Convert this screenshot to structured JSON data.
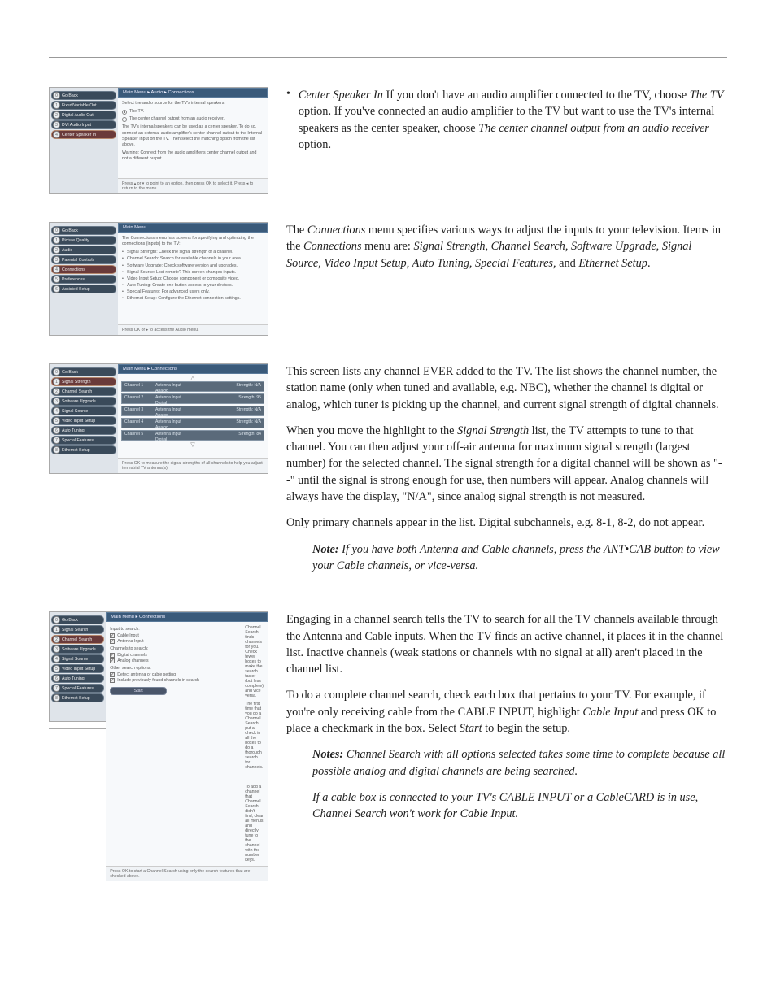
{
  "shot1": {
    "crumb": "Main Menu ▸ Audio ▸ Connections",
    "menu": [
      {
        "n": "0",
        "l": "Go Back",
        "sel": false
      },
      {
        "n": "1",
        "l": "Fixed/Variable Out",
        "sel": false
      },
      {
        "n": "2",
        "l": "Digital Audio Out",
        "sel": false
      },
      {
        "n": "3",
        "l": "DVI Audio Input",
        "sel": false
      },
      {
        "n": "4",
        "l": "Center Speaker In",
        "sel": true
      }
    ],
    "intro": "Select the audio source for the TV's internal speakers:",
    "opt1": "The TV.",
    "opt2": "The center channel output from an audio receiver.",
    "para1": "The TV's internal speakers can be used as a center speaker. To do so, connect an external audio amplifier's center channel output to the Internal Speaker Input on the TV. Then select the matching option from the list above.",
    "para2": "Warning: Connect from the audio amplifier's center channel output and not a different output.",
    "hint": "Press ▴ or ▾ to point to an option, then press OK to select it. Press ◂ to return to the menu."
  },
  "shot2": {
    "crumb": "Main Menu",
    "menu": [
      {
        "n": "0",
        "l": "Go Back",
        "sel": false
      },
      {
        "n": "1",
        "l": "Picture Quality",
        "sel": false
      },
      {
        "n": "2",
        "l": "Audio",
        "sel": false
      },
      {
        "n": "3",
        "l": "Parental Controls",
        "sel": false
      },
      {
        "n": "4",
        "l": "Connections",
        "sel": true
      },
      {
        "n": "5",
        "l": "Preferences",
        "sel": false
      },
      {
        "n": "6",
        "l": "Assisted Setup",
        "sel": false
      }
    ],
    "intro": "The Connections menu has screens for specifying and optimizing the connections (inputs) to the TV:",
    "items": [
      "Signal Strength: Check the signal strength of a channel.",
      "Channel Search: Search for available channels in your area.",
      "Software Upgrade: Check software version and upgrades.",
      "Signal Source: Lost remote? This screen changes inputs.",
      "Video Input Setup: Choose component or composite video.",
      "Auto Tuning: Create one button access to your devices.",
      "Special Features: For advanced users only.",
      "Ethernet Setup: Configure the Ethernet connection settings."
    ],
    "hint": "Press OK or ▸ to access the Audio menu."
  },
  "shot3": {
    "crumb": "Main Menu ▸ Connections",
    "menu": [
      {
        "n": "0",
        "l": "Go Back",
        "sel": false
      },
      {
        "n": "1",
        "l": "Signal Strength",
        "sel": true
      },
      {
        "n": "2",
        "l": "Channel Search",
        "sel": false
      },
      {
        "n": "3",
        "l": "Software Upgrade",
        "sel": false
      },
      {
        "n": "4",
        "l": "Signal Source",
        "sel": false
      },
      {
        "n": "5",
        "l": "Video Input Setup",
        "sel": false
      },
      {
        "n": "6",
        "l": "Auto Tuning",
        "sel": false
      },
      {
        "n": "7",
        "l": "Special Features",
        "sel": false
      },
      {
        "n": "8",
        "l": "Ethernet Setup",
        "sel": false
      }
    ],
    "rows": [
      {
        "ch": "Channel 1",
        "inp": "Antenna Input",
        "typ": "Analog",
        "str": "Strength: N/A"
      },
      {
        "ch": "Channel 2",
        "inp": "Antenna Input",
        "typ": "Digital",
        "str": "Strength: 95"
      },
      {
        "ch": "Channel 3",
        "inp": "Antenna Input",
        "typ": "Analog",
        "str": "Strength: N/A"
      },
      {
        "ch": "Channel 4",
        "inp": "Antenna Input",
        "typ": "Analog",
        "str": "Strength: N/A"
      },
      {
        "ch": "Channel 5",
        "inp": "Antenna Input",
        "typ": "Digital",
        "str": "Strength: 84"
      }
    ],
    "hint": "Press OK to measure the signal strengths of all channels to help you adjust terrestrial TV antenna(s)."
  },
  "shot4": {
    "crumb": "Main Menu ▸ Connections",
    "menu": [
      {
        "n": "0",
        "l": "Go Back",
        "sel": false
      },
      {
        "n": "1",
        "l": "Signal Search",
        "sel": false
      },
      {
        "n": "2",
        "l": "Channel Search",
        "sel": true
      },
      {
        "n": "3",
        "l": "Software Upgrade",
        "sel": false
      },
      {
        "n": "4",
        "l": "Signal Source",
        "sel": false
      },
      {
        "n": "5",
        "l": "Video Input Setup",
        "sel": false
      },
      {
        "n": "6",
        "l": "Auto Tuning",
        "sel": false
      },
      {
        "n": "7",
        "l": "Special Features",
        "sel": false
      },
      {
        "n": "8",
        "l": "Ethernet Setup",
        "sel": false
      }
    ],
    "h1": "Input to search:",
    "c1": "Cable Input",
    "c2": "Antenna Input",
    "h2": "Channels to search:",
    "c3": "Digital channels",
    "c4": "Analog channels",
    "h3": "Other search options:",
    "c5": "Detect antenna or cable setting",
    "c6": "Include previously found channels in search",
    "r1": "Channel Search finds channels for you. Check fewer boxes to make the search faster (but less complete) and vice versa.",
    "r2": "The first time that you do a Channel Search, put a check in all the boxes to do a thorough search for channels.",
    "r3": "To add a channel that Channel Search didn't find, clear all menus and directly tune to the channel with the number keys.",
    "start": "Start",
    "hint": "Press OK to start a Channel Search using only the search features that are checked above."
  },
  "text": {
    "s1": {
      "lead": "Center Speaker In",
      "body": "   If you don't have an audio amplifier connected to the TV, choose ",
      "opt1": "The TV",
      "body2": " option. If you've connected an audio amplifier to the TV but want to use the TV's internal speakers as the center speaker, choose ",
      "opt2": "The center channel output from an audio receiver",
      "body3": " option."
    },
    "s2a": "The ",
    "s2b": "Connections",
    "s2c": " menu specifies various ways to adjust the inputs to your television. Items in the ",
    "s2d": "Connections",
    "s2e": " menu are: ",
    "s2f": "Signal Strength, Channel Search, Software Upgrade, Signal Source, Video Input Setup, Auto Tuning, Special Features,",
    "s2g": " and ",
    "s2h": "Ethernet Setup",
    "s2i": ".",
    "s3p1": "This screen lists any channel EVER added to the TV. The list shows the channel number, the station name (only when tuned and available, e.g. NBC), whether the channel is digital or analog, which tuner is picking up the channel, and current signal strength of digital channels.",
    "s3p2a": "When you move the highlight to the ",
    "s3p2b": "Signal Strength",
    "s3p2c": " list, the TV attempts to tune to that channel. You can then adjust your off-air antenna for maximum signal strength (largest number) for the selected channel. The signal strength for a digital channel will be shown as \"- -\" until the signal is strong enough for use, then numbers will appear. Analog channels will always have the display, \"N/A\", since analog signal strength is not measured.",
    "s3p3": "Only primary channels appear in the list. Digital subchannels, e.g. 8-1, 8-2, do not appear.",
    "s3note_lead": "Note:",
    "s3note": " If you have both Antenna and Cable channels, press the ANT•CAB button to view your Cable channels, or vice-versa.",
    "s4p1": "Engaging in a channel search tells the TV to search for all the TV channels available through the Antenna and Cable inputs. When the TV finds an active channel, it places it in the channel list. Inactive channels (weak stations or channels with no signal at all) aren't placed in the channel list.",
    "s4p2a": "To do a complete channel search, check each box that pertains to your TV. For example, if you're only receiving cable from the CABLE INPUT, highlight ",
    "s4p2b": "Cable Input",
    "s4p2c": " and press OK to place a checkmark in the box. Select ",
    "s4p2d": "Start",
    "s4p2e": " to begin the setup.",
    "s4note_lead": "Notes:",
    "s4note1": " Channel Search with all options selected takes some time to complete because all possible analog and digital channels are being searched.",
    "s4note2": "If a cable box is connected to your TV's CABLE INPUT or a CableCARD is in use, Channel Search won't work for Cable Input."
  },
  "ui": {
    "bullet": "•",
    "tri_up": "△",
    "tri_down": "▽",
    "check": "✓"
  }
}
